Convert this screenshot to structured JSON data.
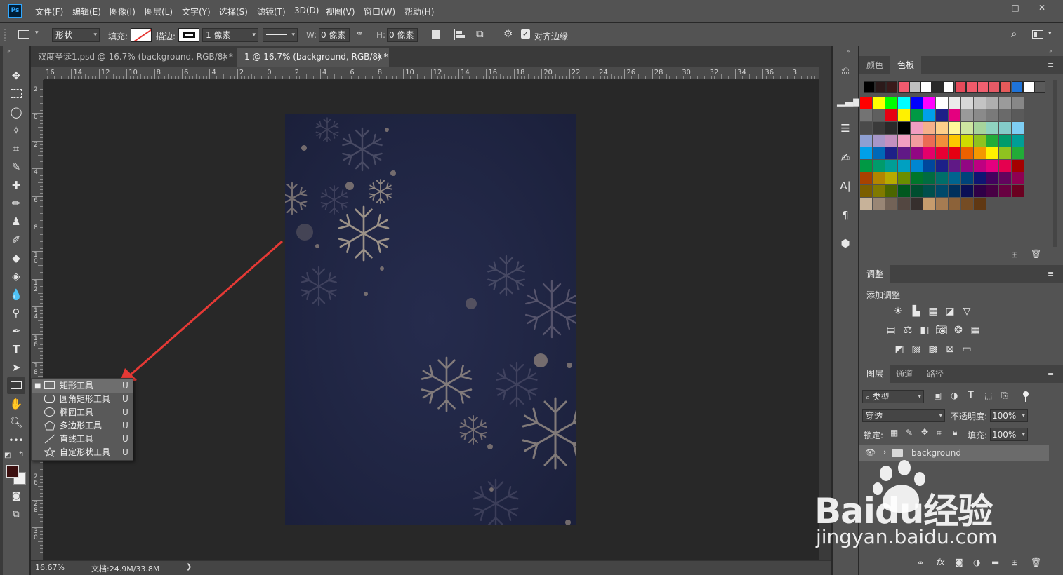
{
  "menubar": {
    "logo": "Ps",
    "items": [
      "文件(F)",
      "编辑(E)",
      "图像(I)",
      "图层(L)",
      "文字(Y)",
      "选择(S)",
      "滤镜(T)",
      "3D(D)",
      "视图(V)",
      "窗口(W)",
      "帮助(H)"
    ],
    "win_min": "—",
    "win_max": "□",
    "win_close": "✕"
  },
  "options": {
    "mode": "形状",
    "fill_label": "填充:",
    "stroke_label": "描边:",
    "stroke_width": "1 像素",
    "w_label": "W:",
    "w_value": "0 像素",
    "h_label": "H:",
    "h_value": "0 像素",
    "align_edges": "对齐边缘"
  },
  "tabs": [
    {
      "label": "双度圣诞1.psd @ 16.7% (background, RGB/8) *",
      "close": "✕"
    },
    {
      "label": "1 @ 16.7% (background, RGB/8) *",
      "close": "✕"
    }
  ],
  "ruler_h": [
    "16",
    "14",
    "12",
    "10",
    "8",
    "6",
    "4",
    "2",
    "0",
    "2",
    "4",
    "6",
    "8",
    "10",
    "12",
    "14",
    "16",
    "18",
    "20",
    "22",
    "24",
    "26",
    "28",
    "30",
    "32",
    "34",
    "36",
    "3"
  ],
  "ruler_v": [
    "2",
    "0",
    "2",
    "4",
    "6",
    "8",
    "1\n0",
    "1\n2",
    "1\n4",
    "1\n6",
    "1\n8",
    "2\n0",
    "2\n2",
    "2\n4",
    "2\n6",
    "2\n8",
    "3\n0"
  ],
  "flyout": {
    "items": [
      {
        "label": "矩形工具",
        "key": "U",
        "icon": "rectangle-icon"
      },
      {
        "label": "圆角矩形工具",
        "key": "U",
        "icon": "rounded-rectangle-icon"
      },
      {
        "label": "椭圆工具",
        "key": "U",
        "icon": "ellipse-icon"
      },
      {
        "label": "多边形工具",
        "key": "U",
        "icon": "polygon-icon"
      },
      {
        "label": "直线工具",
        "key": "U",
        "icon": "line-icon"
      },
      {
        "label": "自定形状工具",
        "key": "U",
        "icon": "custom-shape-icon"
      }
    ]
  },
  "status": {
    "zoom": "16.67%",
    "doc": "文档:24.9M/33.8M",
    "arrow": "❯"
  },
  "swatches_panel": {
    "tab_color": "颜色",
    "tab_swatches": "色板"
  },
  "adjust_panel": {
    "tab": "调整",
    "title": "添加调整"
  },
  "layers_panel": {
    "tab_layers": "图层",
    "tab_channels": "通道",
    "tab_paths": "路径",
    "filter": "类型",
    "blend": "穿透",
    "opacity_label": "不透明度:",
    "opacity": "100%",
    "lock_label": "锁定:",
    "fill_label": "填充:",
    "fill": "100%",
    "layer_name": "background"
  },
  "watermark": {
    "brand": "Baidu经验",
    "url": "jingyan.baidu.com"
  },
  "colors": {
    "accent_arrow": "#e53935",
    "document_bg": "#212746",
    "panel": "#535353"
  }
}
